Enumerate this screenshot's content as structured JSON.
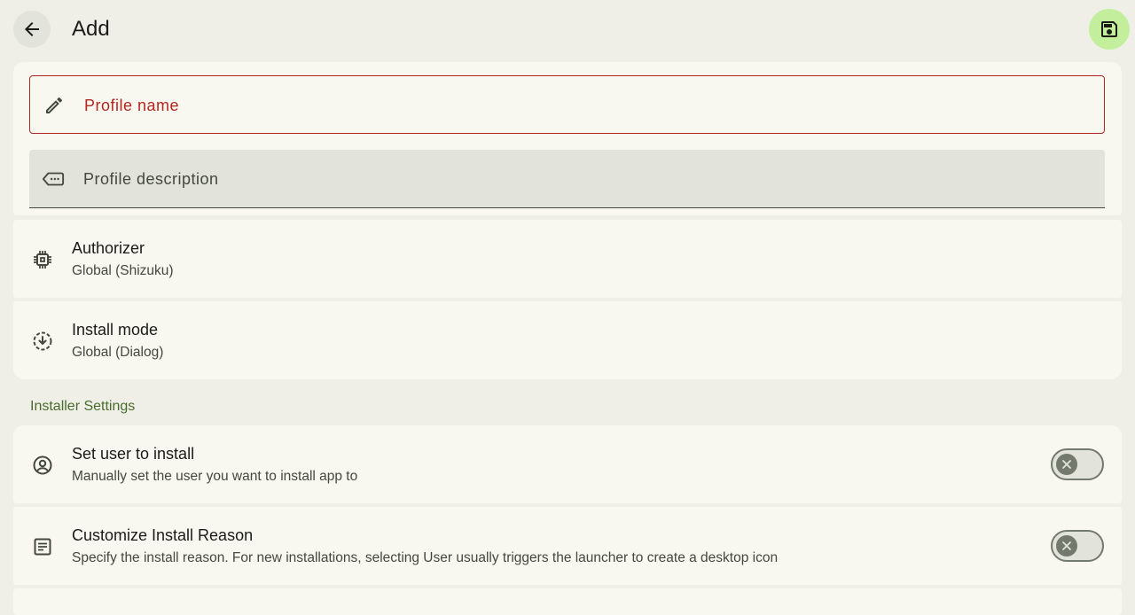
{
  "header": {
    "title": "Add",
    "back_icon": "arrow-left-icon",
    "save_icon": "floppy-disk-icon",
    "save_color": "#c3ef9d"
  },
  "form": {
    "name_placeholder": "Profile name",
    "name_error_color": "#b3261e",
    "description_placeholder": "Profile description"
  },
  "settings": [
    {
      "title": "Authorizer",
      "subtitle": "Global (Shizuku)",
      "icon": "chip-icon"
    },
    {
      "title": "Install mode",
      "subtitle": "Global (Dialog)",
      "icon": "download-circle-icon"
    }
  ],
  "installer_section": {
    "header": "Installer Settings",
    "header_color": "#4a6b2e",
    "items": [
      {
        "title": "Set user to install",
        "subtitle": "Manually set the user you want to install app to",
        "icon": "account-circle-icon",
        "toggle_on": false
      },
      {
        "title": "Customize Install Reason",
        "subtitle": "Specify the install reason. For new installations, selecting User usually triggers the launcher to create a desktop icon",
        "icon": "notes-icon",
        "toggle_on": false
      }
    ]
  }
}
